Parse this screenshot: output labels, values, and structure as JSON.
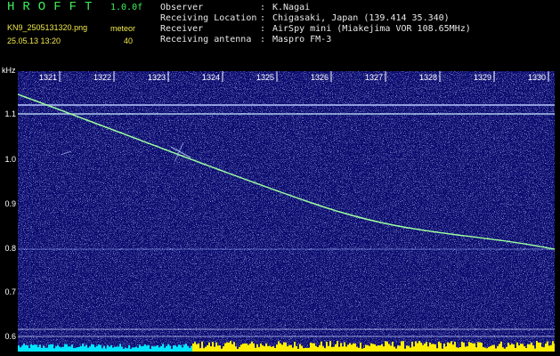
{
  "header": {
    "app_title": "HROFFT",
    "version": "1.0.0f",
    "filename": "KN9_2505131320.png",
    "meteor_label": "meteor",
    "datetime": "25.05.13 13:20",
    "meteor_count": "40"
  },
  "metadata": [
    {
      "label": "Observer",
      "sep": ":",
      "value": "K.Nagai"
    },
    {
      "label": "Receiving Location",
      "sep": ":",
      "value": "Chigasaki, Japan (139.414 35.340)"
    },
    {
      "label": "Receiver",
      "sep": ":",
      "value": "AirSpy mini (Miakejima VOR 108.65MHz)"
    },
    {
      "label": "Receiving antenna",
      "sep": ":",
      "value": "Maspro FM-3"
    }
  ],
  "axes": {
    "freq_unit": "kHz",
    "freq_ticks": [
      "1.1",
      "1.0",
      "0.9",
      "0.8",
      "0.7",
      "0.6"
    ],
    "time_ticks": [
      "1321",
      "1322",
      "1323",
      "1324",
      "1325",
      "1326",
      "1327",
      "1328",
      "1329",
      "1330"
    ]
  },
  "colors": {
    "background": "#0a0a6e",
    "trace": "#9cffa0",
    "title_green": "#3cf05a",
    "label_yellow": "#f2e94a",
    "level_yellow": "#ffee00",
    "level_cyan": "#00e5ff"
  }
}
